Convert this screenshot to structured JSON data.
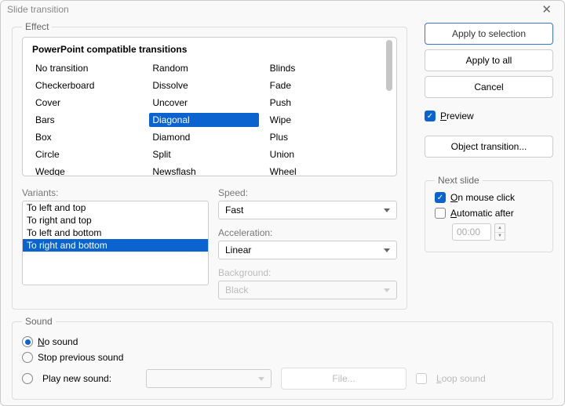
{
  "title": "Slide transition",
  "effectLegend": "Effect",
  "effectHeader": "PowerPoint compatible transitions",
  "effects": {
    "col1": [
      "No transition",
      "Checkerboard",
      "Cover",
      "Bars",
      "Box",
      "Circle",
      "Wedge"
    ],
    "col2": [
      "Random",
      "Dissolve",
      "Uncover",
      "Diagonal",
      "Diamond",
      "Split",
      "Newsflash"
    ],
    "col3": [
      "Blinds",
      "Fade",
      "Push",
      "Wipe",
      "Plus",
      "Union",
      "Wheel"
    ]
  },
  "selectedEffect": "Diagonal",
  "variantsLabel": "Variants:",
  "variants": [
    "To left and top",
    "To right and top",
    "To left and bottom",
    "To right and bottom"
  ],
  "selectedVariant": "To right and bottom",
  "speedLabel": "Speed:",
  "speedValue": "Fast",
  "accelLabel": "Acceleration:",
  "accelValue": "Linear",
  "bgLabel": "Background:",
  "bgValue": "Black",
  "buttons": {
    "apply": "Apply to selection",
    "applyAll": "Apply to all",
    "cancel": "Cancel",
    "objTrans": "Object transition..."
  },
  "previewLabel": "Preview",
  "nextSlide": {
    "legend": "Next slide",
    "onClick": "On mouse click",
    "autoAfter": "Automatic after",
    "time": "00:00"
  },
  "sound": {
    "legend": "Sound",
    "none": "No sound",
    "stop": "Stop previous sound",
    "play": "Play new sound:",
    "file": "File...",
    "loop": "Loop sound"
  },
  "u": {
    "preview": "P",
    "onClick": "O",
    "auto": "A",
    "none": "N",
    "loop": "L"
  }
}
